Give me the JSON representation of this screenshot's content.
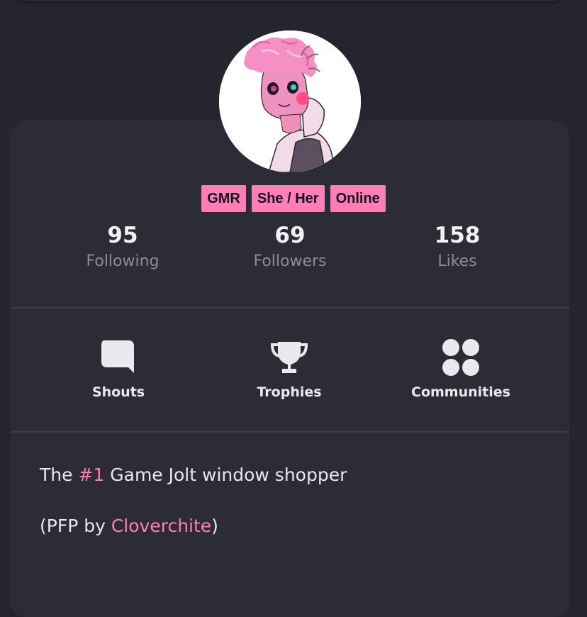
{
  "colors": {
    "background": "#24252e",
    "card": "#2b2c35",
    "accent": "#ff7eb9",
    "muted_text": "#8b8c96",
    "divider": "#3d3e48"
  },
  "avatar": {
    "icon": "profile-avatar-image"
  },
  "tags": [
    "GMR",
    "She / Her",
    "Online"
  ],
  "stats": [
    {
      "value": "95",
      "label": "Following"
    },
    {
      "value": "69",
      "label": "Followers"
    },
    {
      "value": "158",
      "label": "Likes"
    }
  ],
  "nav": [
    {
      "label": "Shouts",
      "icon": "speech-bubble-icon"
    },
    {
      "label": "Trophies",
      "icon": "trophy-icon"
    },
    {
      "label": "Communities",
      "icon": "four-circles-icon"
    }
  ],
  "bio": {
    "line1_prefix": "The ",
    "line1_link": "#1",
    "line1_suffix": " Game Jolt window shopper",
    "line2_prefix": "(PFP by ",
    "line2_link": "Cloverchite",
    "line2_suffix": ")"
  }
}
